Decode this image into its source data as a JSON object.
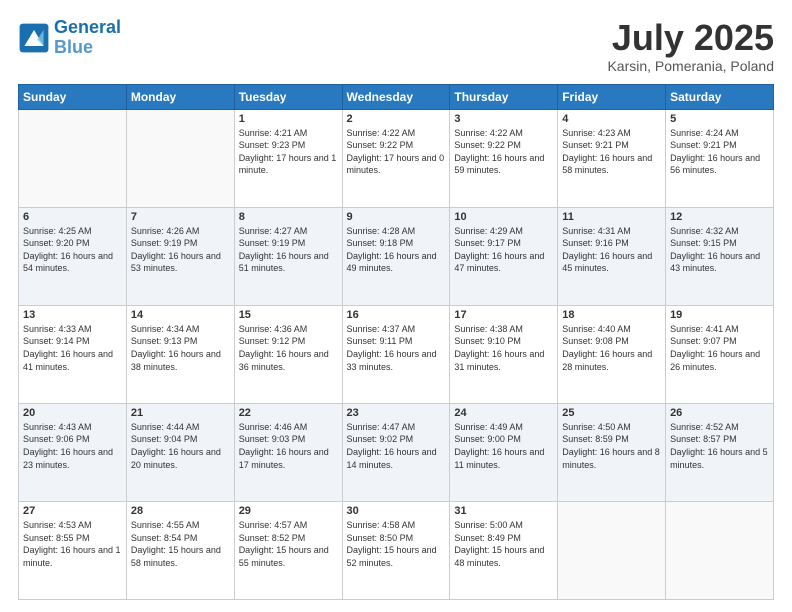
{
  "header": {
    "logo_line1": "General",
    "logo_line2": "Blue",
    "month": "July 2025",
    "location": "Karsin, Pomerania, Poland"
  },
  "weekdays": [
    "Sunday",
    "Monday",
    "Tuesday",
    "Wednesday",
    "Thursday",
    "Friday",
    "Saturday"
  ],
  "weeks": [
    [
      {
        "day": "",
        "sunrise": "",
        "sunset": "",
        "daylight": ""
      },
      {
        "day": "",
        "sunrise": "",
        "sunset": "",
        "daylight": ""
      },
      {
        "day": "1",
        "sunrise": "Sunrise: 4:21 AM",
        "sunset": "Sunset: 9:23 PM",
        "daylight": "Daylight: 17 hours and 1 minute."
      },
      {
        "day": "2",
        "sunrise": "Sunrise: 4:22 AM",
        "sunset": "Sunset: 9:22 PM",
        "daylight": "Daylight: 17 hours and 0 minutes."
      },
      {
        "day": "3",
        "sunrise": "Sunrise: 4:22 AM",
        "sunset": "Sunset: 9:22 PM",
        "daylight": "Daylight: 16 hours and 59 minutes."
      },
      {
        "day": "4",
        "sunrise": "Sunrise: 4:23 AM",
        "sunset": "Sunset: 9:21 PM",
        "daylight": "Daylight: 16 hours and 58 minutes."
      },
      {
        "day": "5",
        "sunrise": "Sunrise: 4:24 AM",
        "sunset": "Sunset: 9:21 PM",
        "daylight": "Daylight: 16 hours and 56 minutes."
      }
    ],
    [
      {
        "day": "6",
        "sunrise": "Sunrise: 4:25 AM",
        "sunset": "Sunset: 9:20 PM",
        "daylight": "Daylight: 16 hours and 54 minutes."
      },
      {
        "day": "7",
        "sunrise": "Sunrise: 4:26 AM",
        "sunset": "Sunset: 9:19 PM",
        "daylight": "Daylight: 16 hours and 53 minutes."
      },
      {
        "day": "8",
        "sunrise": "Sunrise: 4:27 AM",
        "sunset": "Sunset: 9:19 PM",
        "daylight": "Daylight: 16 hours and 51 minutes."
      },
      {
        "day": "9",
        "sunrise": "Sunrise: 4:28 AM",
        "sunset": "Sunset: 9:18 PM",
        "daylight": "Daylight: 16 hours and 49 minutes."
      },
      {
        "day": "10",
        "sunrise": "Sunrise: 4:29 AM",
        "sunset": "Sunset: 9:17 PM",
        "daylight": "Daylight: 16 hours and 47 minutes."
      },
      {
        "day": "11",
        "sunrise": "Sunrise: 4:31 AM",
        "sunset": "Sunset: 9:16 PM",
        "daylight": "Daylight: 16 hours and 45 minutes."
      },
      {
        "day": "12",
        "sunrise": "Sunrise: 4:32 AM",
        "sunset": "Sunset: 9:15 PM",
        "daylight": "Daylight: 16 hours and 43 minutes."
      }
    ],
    [
      {
        "day": "13",
        "sunrise": "Sunrise: 4:33 AM",
        "sunset": "Sunset: 9:14 PM",
        "daylight": "Daylight: 16 hours and 41 minutes."
      },
      {
        "day": "14",
        "sunrise": "Sunrise: 4:34 AM",
        "sunset": "Sunset: 9:13 PM",
        "daylight": "Daylight: 16 hours and 38 minutes."
      },
      {
        "day": "15",
        "sunrise": "Sunrise: 4:36 AM",
        "sunset": "Sunset: 9:12 PM",
        "daylight": "Daylight: 16 hours and 36 minutes."
      },
      {
        "day": "16",
        "sunrise": "Sunrise: 4:37 AM",
        "sunset": "Sunset: 9:11 PM",
        "daylight": "Daylight: 16 hours and 33 minutes."
      },
      {
        "day": "17",
        "sunrise": "Sunrise: 4:38 AM",
        "sunset": "Sunset: 9:10 PM",
        "daylight": "Daylight: 16 hours and 31 minutes."
      },
      {
        "day": "18",
        "sunrise": "Sunrise: 4:40 AM",
        "sunset": "Sunset: 9:08 PM",
        "daylight": "Daylight: 16 hours and 28 minutes."
      },
      {
        "day": "19",
        "sunrise": "Sunrise: 4:41 AM",
        "sunset": "Sunset: 9:07 PM",
        "daylight": "Daylight: 16 hours and 26 minutes."
      }
    ],
    [
      {
        "day": "20",
        "sunrise": "Sunrise: 4:43 AM",
        "sunset": "Sunset: 9:06 PM",
        "daylight": "Daylight: 16 hours and 23 minutes."
      },
      {
        "day": "21",
        "sunrise": "Sunrise: 4:44 AM",
        "sunset": "Sunset: 9:04 PM",
        "daylight": "Daylight: 16 hours and 20 minutes."
      },
      {
        "day": "22",
        "sunrise": "Sunrise: 4:46 AM",
        "sunset": "Sunset: 9:03 PM",
        "daylight": "Daylight: 16 hours and 17 minutes."
      },
      {
        "day": "23",
        "sunrise": "Sunrise: 4:47 AM",
        "sunset": "Sunset: 9:02 PM",
        "daylight": "Daylight: 16 hours and 14 minutes."
      },
      {
        "day": "24",
        "sunrise": "Sunrise: 4:49 AM",
        "sunset": "Sunset: 9:00 PM",
        "daylight": "Daylight: 16 hours and 11 minutes."
      },
      {
        "day": "25",
        "sunrise": "Sunrise: 4:50 AM",
        "sunset": "Sunset: 8:59 PM",
        "daylight": "Daylight: 16 hours and 8 minutes."
      },
      {
        "day": "26",
        "sunrise": "Sunrise: 4:52 AM",
        "sunset": "Sunset: 8:57 PM",
        "daylight": "Daylight: 16 hours and 5 minutes."
      }
    ],
    [
      {
        "day": "27",
        "sunrise": "Sunrise: 4:53 AM",
        "sunset": "Sunset: 8:55 PM",
        "daylight": "Daylight: 16 hours and 1 minute."
      },
      {
        "day": "28",
        "sunrise": "Sunrise: 4:55 AM",
        "sunset": "Sunset: 8:54 PM",
        "daylight": "Daylight: 15 hours and 58 minutes."
      },
      {
        "day": "29",
        "sunrise": "Sunrise: 4:57 AM",
        "sunset": "Sunset: 8:52 PM",
        "daylight": "Daylight: 15 hours and 55 minutes."
      },
      {
        "day": "30",
        "sunrise": "Sunrise: 4:58 AM",
        "sunset": "Sunset: 8:50 PM",
        "daylight": "Daylight: 15 hours and 52 minutes."
      },
      {
        "day": "31",
        "sunrise": "Sunrise: 5:00 AM",
        "sunset": "Sunset: 8:49 PM",
        "daylight": "Daylight: 15 hours and 48 minutes."
      },
      {
        "day": "",
        "sunrise": "",
        "sunset": "",
        "daylight": ""
      },
      {
        "day": "",
        "sunrise": "",
        "sunset": "",
        "daylight": ""
      }
    ]
  ]
}
